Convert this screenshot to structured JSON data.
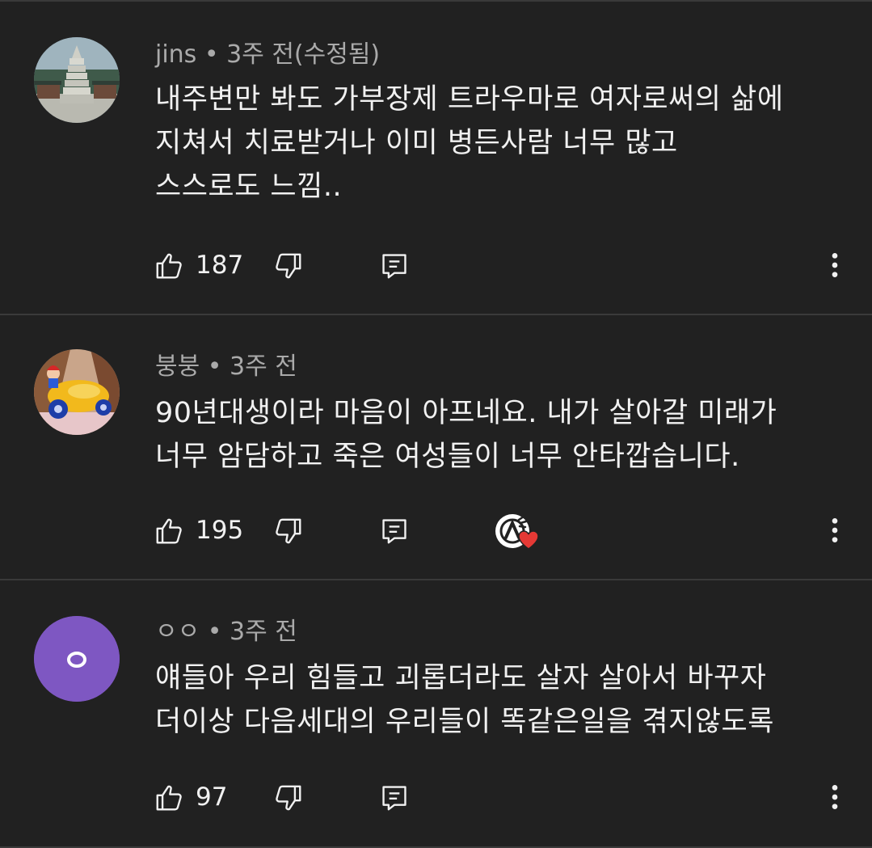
{
  "comments": [
    {
      "author": "jins",
      "time": "3주 전(수정됨)",
      "text": "내주변만 봐도 가부장제 트라우마로 여자로써의 삶에\n지쳐서 치료받거나 이미 병든사람 너무 많고\n스스로도 느낌..",
      "likes": "187",
      "avatar": "pagoda-photo",
      "heart": false
    },
    {
      "author": "붕붕",
      "time": "3주 전",
      "text": "90년대생이라 마음이 아프네요. 내가 살아갈 미래가\n너무 암담하고 죽은 여성들이 너무 안타깝습니다.",
      "likes": "195",
      "avatar": "cartoon-car",
      "heart": true
    },
    {
      "author": "ㅇㅇ",
      "time": "3주 전",
      "text": "얘들아 우리 힘들고 괴롭더라도 살자 살아서 바꾸자\n더이상 다음세대의 우리들이 똑같은일을 겪지않도록",
      "likes": "97",
      "avatar": "letter-avatar",
      "avatar_letter": "ㅇ",
      "avatar_color": "#7e57c2",
      "heart": false
    }
  ],
  "separator": " • ",
  "icons": {
    "like": "thumbs-up-icon",
    "dislike": "thumbs-down-icon",
    "reply": "reply-icon",
    "more": "more-vert-icon",
    "heart": "creator-heart-icon"
  },
  "colors": {
    "background": "#212121",
    "text": "#f1f1f1",
    "meta": "#aaaaaa",
    "divider": "#3a3a3a",
    "heart": "#e53935"
  }
}
